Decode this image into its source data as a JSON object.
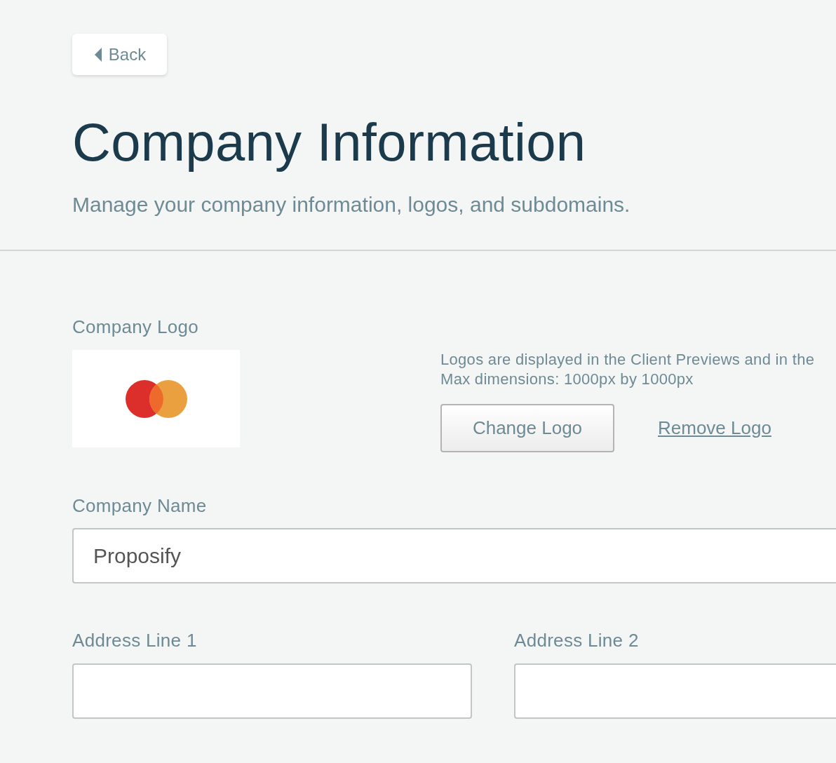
{
  "back_button": {
    "label": "Back"
  },
  "header": {
    "title": "Company Information",
    "subtitle": "Manage your company information, logos, and subdomains."
  },
  "logo_section": {
    "label": "Company Logo",
    "hint_lines": [
      "Logos are displayed in the Client Previews and in the",
      "Max dimensions: 1000px by 1000px"
    ],
    "change_button": "Change Logo",
    "remove_link": "Remove Logo"
  },
  "name_field": {
    "label": "Company Name",
    "value": "Proposify"
  },
  "address_fields": [
    {
      "label": "Address Line 1"
    },
    {
      "label": "Address Line 2"
    }
  ]
}
